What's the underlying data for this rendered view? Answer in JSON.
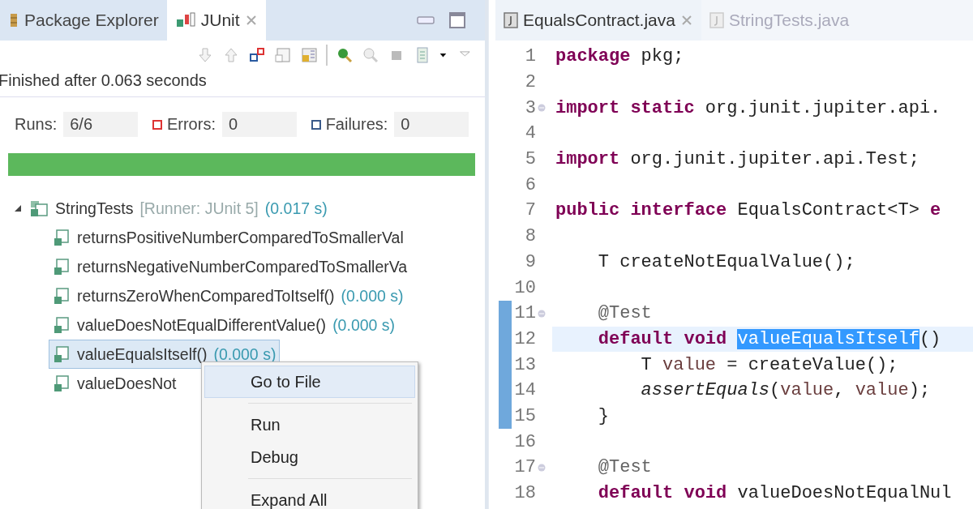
{
  "left_view": {
    "tabs": [
      {
        "label": "Package Explorer",
        "selected": false
      },
      {
        "label": "JUnit",
        "selected": true
      }
    ],
    "status": "Finished after 0.063 seconds",
    "counters": [
      {
        "label": "Runs:",
        "value": "6/6",
        "kind": "runs"
      },
      {
        "label": "Errors:",
        "value": "0",
        "kind": "errors"
      },
      {
        "label": "Failures:",
        "value": "0",
        "kind": "failures"
      }
    ],
    "progress": {
      "level": 1
    },
    "tree": {
      "name": "StringTests",
      "runner": "[Runner: JUnit 5]",
      "time": "(0.017 s)",
      "expanded": true,
      "children": [
        {
          "name": "returnsPositiveNumberComparedToSmallerVal",
          "selected": false
        },
        {
          "name": "returnsNegativeNumberComparedToSmallerVa",
          "selected": false
        },
        {
          "name": "returnsZeroWhenComparedToItself()",
          "time": "(0.000 s)",
          "selected": false
        },
        {
          "name": "valueDoesNotEqualDifferentValue()",
          "time": "(0.000 s)",
          "selected": false
        },
        {
          "name": "valueEqualsItself()",
          "time": "(0.000 s)",
          "selected": true
        },
        {
          "name": "valueDoesNot",
          "selected": false
        }
      ]
    },
    "context_menu": {
      "groups": [
        [
          {
            "label": "Go to File",
            "selected": true
          }
        ],
        [
          {
            "label": "Run",
            "selected": false
          },
          {
            "label": "Debug",
            "selected": false
          }
        ],
        [
          {
            "label": "Expand All",
            "selected": false
          }
        ]
      ]
    }
  },
  "editor": {
    "tabs": [
      {
        "label": "EqualsContract.java",
        "selected": true
      },
      {
        "label": "StringTests.java",
        "selected": false
      }
    ],
    "lines": [
      {
        "number": "1",
        "tokens": [
          {
            "text": "package",
            "kind": "keyword"
          },
          {
            "text": " pkg;",
            "kind": "plain"
          }
        ]
      },
      {
        "number": "2"
      },
      {
        "number": "3",
        "fold": true,
        "tokens": [
          {
            "text": "import",
            "kind": "keyword"
          },
          {
            "text": " static",
            "kind": "keyword"
          },
          {
            "text": " org.junit.jupiter.api.",
            "kind": "plain"
          }
        ]
      },
      {
        "number": "4"
      },
      {
        "number": "5",
        "tokens": [
          {
            "text": "import",
            "kind": "keyword"
          },
          {
            "text": " org.junit.jupiter.api.Test;",
            "kind": "plain"
          }
        ]
      },
      {
        "number": "6"
      },
      {
        "number": "7",
        "tokens": [
          {
            "text": "public",
            "kind": "keyword"
          },
          {
            "text": " interface",
            "kind": "keyword"
          },
          {
            "text": " EqualsContract<T>",
            "kind": "plain"
          },
          {
            "text": " e",
            "kind": "keyword"
          }
        ]
      },
      {
        "number": "8"
      },
      {
        "number": "9",
        "tokens": [
          {
            "text": "    T createNotEqualValue();",
            "kind": "plain"
          }
        ]
      },
      {
        "number": "10"
      },
      {
        "number": "11",
        "fold": true,
        "changed": true,
        "tokens": [
          {
            "text": "    @Test",
            "kind": "annotation"
          }
        ]
      },
      {
        "number": "12",
        "changed": true,
        "current": true,
        "tokens": [
          {
            "text": "    default",
            "kind": "keyword"
          },
          {
            "text": " void ",
            "kind": "keyword"
          },
          {
            "text": "valueEqualsItself",
            "kind": "selection"
          },
          {
            "text": "()",
            "kind": "plain"
          }
        ]
      },
      {
        "number": "13",
        "changed": true,
        "tokens": [
          {
            "text": "        T",
            "kind": "plain"
          },
          {
            "text": " value",
            "kind": "variable"
          },
          {
            "text": " = createValue();",
            "kind": "plain"
          }
        ]
      },
      {
        "number": "14",
        "changed": true,
        "tokens": [
          {
            "text": "        assertEquals",
            "kind": "static"
          },
          {
            "text": "(",
            "kind": "plain"
          },
          {
            "text": "value",
            "kind": "variable"
          },
          {
            "text": ",",
            "kind": "plain"
          },
          {
            "text": " value",
            "kind": "variable"
          },
          {
            "text": ");",
            "kind": "plain"
          }
        ]
      },
      {
        "number": "15",
        "changed": true,
        "tokens": [
          {
            "text": "    }",
            "kind": "plain"
          }
        ]
      },
      {
        "number": "16"
      },
      {
        "number": "17",
        "fold": true,
        "tokens": [
          {
            "text": "    @Test",
            "kind": "annotation"
          }
        ]
      },
      {
        "number": "18",
        "tokens": [
          {
            "text": "    default",
            "kind": "keyword"
          },
          {
            "text": " void",
            "kind": "keyword"
          },
          {
            "text": " valueDoesNotEqualNul",
            "kind": "plain"
          }
        ]
      }
    ]
  }
}
